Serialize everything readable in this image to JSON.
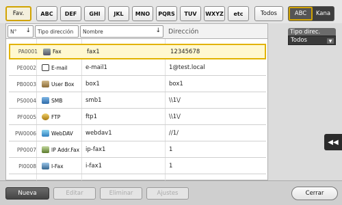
{
  "index_tabs": {
    "favorites": "Fav.",
    "letters": [
      "ABC",
      "DEF",
      "GHI",
      "JKL",
      "MNO",
      "PQRS",
      "TUV",
      "WXYZ",
      "etc"
    ],
    "all": "Todos"
  },
  "alphabet_toggle": {
    "abc": "ABC",
    "kana": "Kana",
    "active": "ABC"
  },
  "table": {
    "headers": {
      "number": "N°",
      "type": "Tipo dirección",
      "name": "Nombre",
      "address": "Dirección"
    },
    "rows": [
      {
        "number": "PA0001",
        "type": "Fax",
        "icon": "fax-icon",
        "name": "fax1",
        "address": "12345678",
        "selected": true
      },
      {
        "number": "PE0002",
        "type": "E-mail",
        "icon": "email-icon",
        "name": "e-mail1",
        "address": "1@test.local",
        "selected": false
      },
      {
        "number": "PB0003",
        "type": "User Box",
        "icon": "user-box-icon",
        "name": "box1",
        "address": "box1",
        "selected": false
      },
      {
        "number": "PS0004",
        "type": "SMB",
        "icon": "smb-icon",
        "name": "smb1",
        "address": "\\\\1\\/",
        "selected": false
      },
      {
        "number": "PF0005",
        "type": "FTP",
        "icon": "ftp-icon",
        "name": "ftp1",
        "address": "\\\\1\\/",
        "selected": false
      },
      {
        "number": "PW0006",
        "type": "WebDAV",
        "icon": "webdav-icon",
        "name": "webdav1",
        "address": "//1/",
        "selected": false
      },
      {
        "number": "PP0007",
        "type": "IP Addr.Fax",
        "icon": "ip-fax-icon",
        "name": "ip-fax1",
        "address": "1",
        "selected": false
      },
      {
        "number": "PI0008",
        "type": "I-Fax",
        "icon": "i-fax-icon",
        "name": "i-fax1",
        "address": "1",
        "selected": false
      }
    ]
  },
  "filter": {
    "label": "Tipo direc.",
    "value": "Todos"
  },
  "actions": {
    "new": "Nueva",
    "edit": "Editar",
    "delete": "Eliminar",
    "settings": "Ajustes",
    "close": "Cerrar"
  },
  "colors": {
    "accent": "#e2b300",
    "dark": "#3e3e3e"
  }
}
